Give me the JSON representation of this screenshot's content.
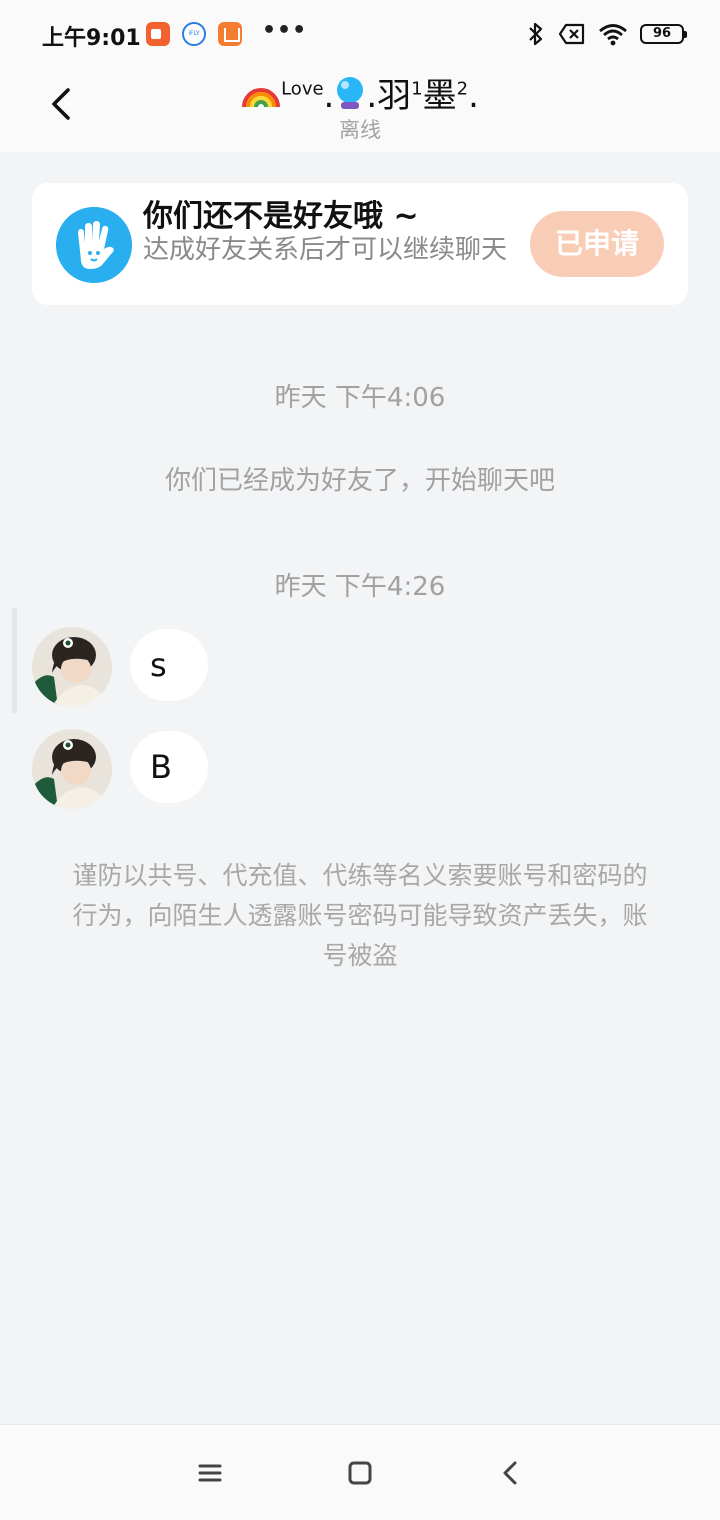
{
  "status_bar": {
    "time": "上午9:01",
    "ifly_label": "iFLY",
    "more_dots": "•••",
    "battery": "96"
  },
  "header": {
    "title_love": "Love",
    "dot1": ".",
    "dot2": ".",
    "name_part1": "羽",
    "sup1": "1",
    "name_part2": "墨",
    "sup2": "2",
    "dot3": ".",
    "status": "离线"
  },
  "friend_card": {
    "title": "你们还不是好友哦 ~",
    "text": "达成好友关系后才可以继续聊天",
    "button_label": "已申请"
  },
  "chat": {
    "timestamp_1": "昨天 下午4:06",
    "system_message": "你们已经成为好友了，开始聊天吧",
    "timestamp_2": "昨天 下午4:26",
    "messages": [
      {
        "text": "s"
      },
      {
        "text": "B"
      }
    ],
    "warning": "谨防以共号、代充值、代练等名义索要账号和密码的行为，向陌生人透露账号密码可能导致资产丢失，账号被盗"
  },
  "colors": {
    "background": "#f2f4f6",
    "accent_blue": "#29aef0",
    "applied_button": "#f9cdb5"
  }
}
